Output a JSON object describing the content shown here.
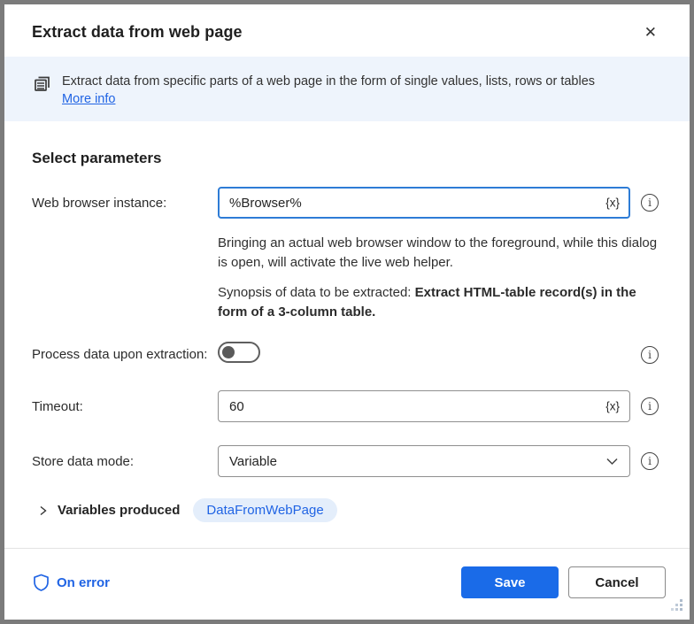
{
  "colors": {
    "accent_blue": "#1A6BE8",
    "link_blue": "#2064E4",
    "focus_border": "#2E7CD6",
    "banner_bg": "#EEF4FC",
    "badge_bg": "#E4EEFB",
    "outer_border": "#7B7B7B"
  },
  "dialog": {
    "title": "Extract data from web page",
    "close_glyph": "✕"
  },
  "banner": {
    "icon": "extract-data-document-icon",
    "description": "Extract data from specific parts of a web page in the form of single values, lists, rows or tables",
    "more_info_label": "More info"
  },
  "parameters": {
    "heading": "Select parameters",
    "web_browser_instance": {
      "label": "Web browser instance:",
      "value": "%Browser%",
      "fx_label": "{x}",
      "info_glyph": "i"
    },
    "helper_note": "Bringing an actual web browser window to the foreground, while this dialog is open, will activate the live web helper.",
    "synopsis_prefix": "Synopsis of data to be extracted: ",
    "synopsis_bold": "Extract HTML-table record(s) in the form of a 3-column table.",
    "process_data": {
      "label": "Process data upon extraction:",
      "state": "off",
      "info_glyph": "i"
    },
    "timeout": {
      "label": "Timeout:",
      "value": "60",
      "fx_label": "{x}",
      "info_glyph": "i"
    },
    "store_data_mode": {
      "label": "Store data mode:",
      "value": "Variable",
      "info_glyph": "i"
    }
  },
  "variables_produced": {
    "label": "Variables produced",
    "variable_name": "DataFromWebPage"
  },
  "footer": {
    "on_error_label": "On error",
    "save_label": "Save",
    "cancel_label": "Cancel"
  }
}
